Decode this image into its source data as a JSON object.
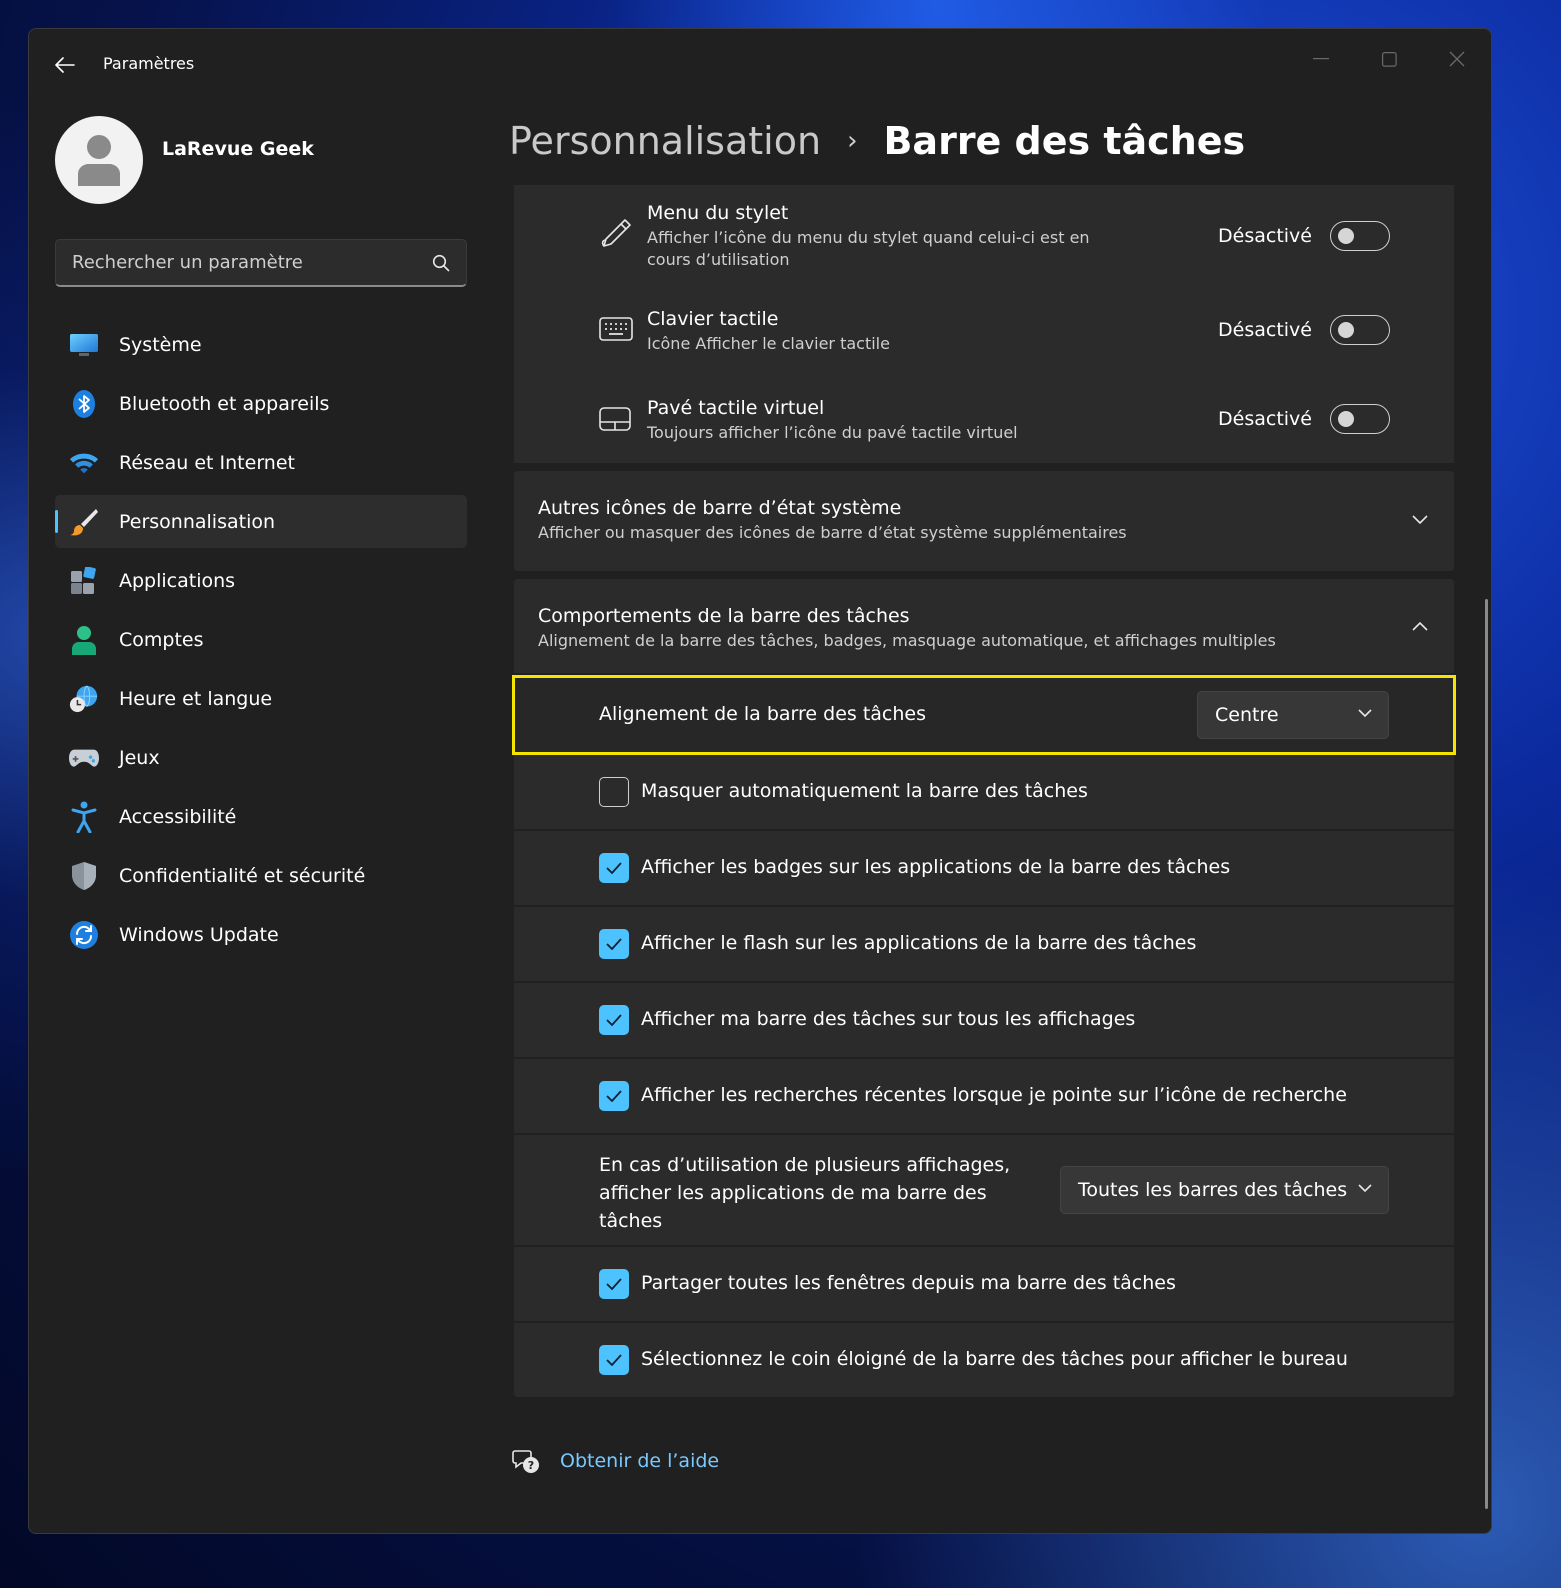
{
  "window": {
    "title": "Paramètres"
  },
  "profile": {
    "name": "LaRevue Geek"
  },
  "search": {
    "placeholder": "Rechercher un paramètre"
  },
  "nav": {
    "items": [
      {
        "label": "Système",
        "icon": "monitor-icon"
      },
      {
        "label": "Bluetooth et appareils",
        "icon": "bluetooth-icon"
      },
      {
        "label": "Réseau et Internet",
        "icon": "wifi-icon"
      },
      {
        "label": "Personnalisation",
        "icon": "brush-icon",
        "active": true
      },
      {
        "label": "Applications",
        "icon": "apps-icon"
      },
      {
        "label": "Comptes",
        "icon": "account-icon"
      },
      {
        "label": "Heure et langue",
        "icon": "clock-globe-icon"
      },
      {
        "label": "Jeux",
        "icon": "gamepad-icon"
      },
      {
        "label": "Accessibilité",
        "icon": "accessibility-icon"
      },
      {
        "label": "Confidentialité et sécurité",
        "icon": "shield-icon"
      },
      {
        "label": "Windows Update",
        "icon": "update-icon"
      }
    ]
  },
  "breadcrumb": {
    "parent": "Personnalisation",
    "separator": "›",
    "current": "Barre des tâches"
  },
  "corner_icons": {
    "items": [
      {
        "title": "Menu du stylet",
        "subtitle": "Afficher l’icône du menu du stylet quand celui-ci est en cours d’utilisation",
        "state": "Désactivé",
        "icon": "pen-icon"
      },
      {
        "title": "Clavier tactile",
        "subtitle": "Icône Afficher le clavier tactile",
        "state": "Désactivé",
        "icon": "keyboard-icon"
      },
      {
        "title": "Pavé tactile virtuel",
        "subtitle": "Toujours afficher l’icône du pavé tactile virtuel",
        "state": "Désactivé",
        "icon": "touchpad-icon"
      }
    ]
  },
  "other_tray": {
    "title": "Autres icônes de barre d’état système",
    "subtitle": "Afficher ou masquer des icônes de barre d’état système supplémentaires"
  },
  "behaviors": {
    "title": "Comportements de la barre des tâches",
    "subtitle": "Alignement de la barre des tâches, badges, masquage automatique, et affichages multiples",
    "alignment_label": "Alignement de la barre des tâches",
    "alignment_value": "Centre",
    "checks": [
      {
        "label": "Masquer automatiquement la barre des tâches",
        "checked": false
      },
      {
        "label": "Afficher les badges sur les applications de la barre des tâches",
        "checked": true
      },
      {
        "label": "Afficher le flash sur les applications de la barre des tâches",
        "checked": true
      },
      {
        "label": "Afficher ma barre des tâches sur tous les affichages",
        "checked": true
      },
      {
        "label": "Afficher les recherches récentes lorsque je pointe sur l’icône de recherche",
        "checked": true
      }
    ],
    "multi_display_label": "En cas d’utilisation de plusieurs affichages, afficher les applications de ma barre des tâches",
    "multi_display_value": "Toutes les barres des tâches",
    "checks2": [
      {
        "label": "Partager toutes les fenêtres depuis ma barre des tâches",
        "checked": true
      },
      {
        "label": "Sélectionnez le coin éloigné de la barre des tâches pour afficher le bureau",
        "checked": true
      }
    ]
  },
  "help": {
    "label": "Obtenir de l’aide"
  },
  "colors": {
    "accent": "#4cc2ff",
    "highlight": "#f5e400",
    "window_bg": "#202020",
    "card_bg": "#2b2b2b"
  }
}
